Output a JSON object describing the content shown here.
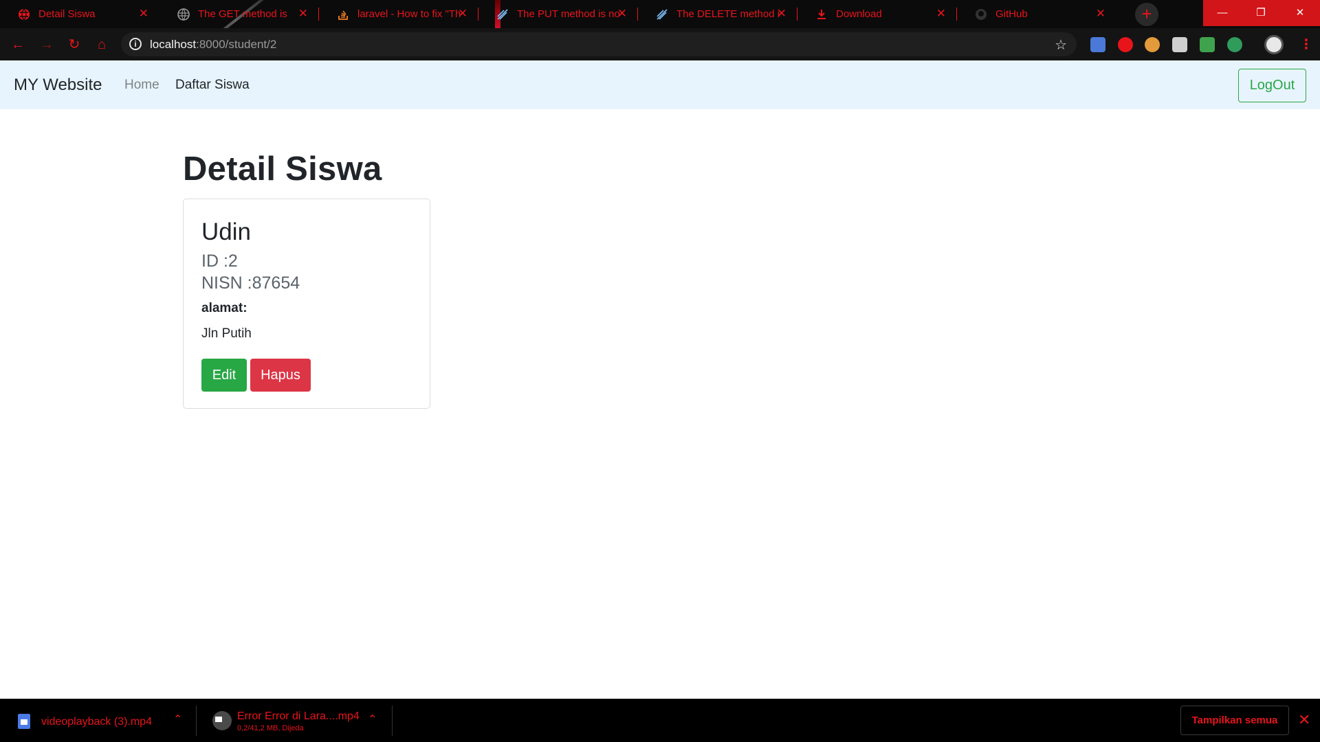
{
  "browser": {
    "tabs": [
      {
        "title": "Detail Siswa",
        "icon": "globe-icon"
      },
      {
        "title": "The GET method is",
        "icon": "globe-icon"
      },
      {
        "title": "laravel - How to fix \"Th",
        "icon": "stackoverflow-icon"
      },
      {
        "title": "The PUT method is not",
        "icon": "laracasts-icon"
      },
      {
        "title": "The DELETE method is",
        "icon": "laracasts-icon"
      },
      {
        "title": "Download",
        "icon": "download-icon"
      },
      {
        "title": "GitHub",
        "icon": "github-icon"
      }
    ],
    "address": {
      "host": "localhost",
      "path": ":8000/student/2"
    },
    "accent_color": "#e8141c"
  },
  "navbar": {
    "brand": "MY Website",
    "links": [
      "Home",
      "Daftar Siswa"
    ],
    "logout": "LogOut"
  },
  "main": {
    "title": "Detail Siswa",
    "card": {
      "name": "Udin",
      "id_line": "ID :2",
      "nisn_line": "NISN :87654",
      "address_label": "alamat:",
      "address_value": "Jln Putih",
      "edit_label": "Edit",
      "delete_label": "Hapus"
    }
  },
  "downloads": {
    "items": [
      {
        "name": "videoplayback (3).mp4",
        "status": ""
      },
      {
        "name": "Error Error di Lara....mp4",
        "status": "0,2/41,2 MB, Dijeda"
      }
    ],
    "show_all": "Tampilkan semua"
  }
}
